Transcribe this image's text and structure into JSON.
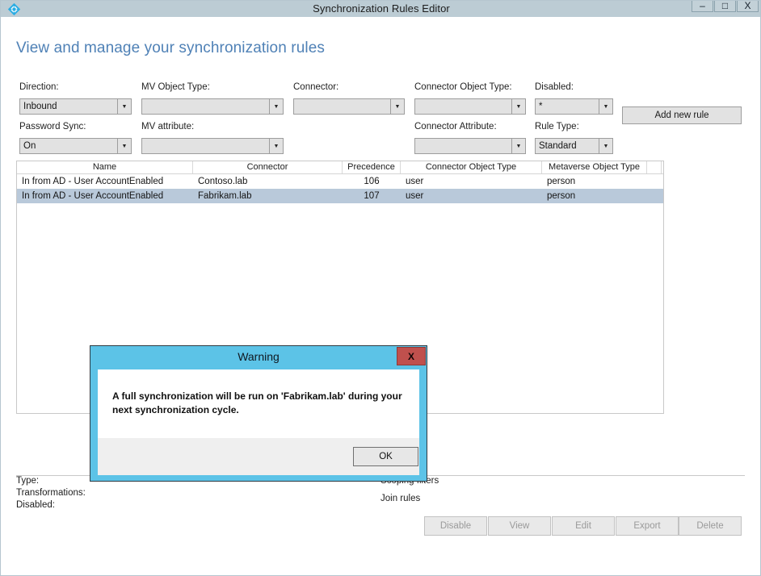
{
  "window": {
    "title": "Synchronization Rules Editor",
    "app_icon": "azure-ad-connect-diamond-icon",
    "controls": {
      "minimize": "–",
      "maximize": "□",
      "close": "X"
    }
  },
  "page": {
    "heading": "View and manage your synchronization rules"
  },
  "filters": {
    "direction": {
      "label": "Direction:",
      "value": "Inbound"
    },
    "mv_object_type": {
      "label": "MV Object Type:",
      "value": ""
    },
    "connector": {
      "label": "Connector:",
      "value": ""
    },
    "connector_object_type": {
      "label": "Connector Object Type:",
      "value": ""
    },
    "disabled": {
      "label": "Disabled:",
      "value": "*"
    },
    "password_sync": {
      "label": "Password Sync:",
      "value": "On"
    },
    "mv_attribute": {
      "label": "MV attribute:",
      "value": ""
    },
    "connector_attribute": {
      "label": "Connector Attribute:",
      "value": ""
    },
    "rule_type": {
      "label": "Rule Type:",
      "value": "Standard"
    },
    "add_new_rule_label": "Add new rule"
  },
  "grid": {
    "columns": [
      "Name",
      "Connector",
      "Precedence",
      "Connector Object Type",
      "Metaverse Object Type",
      ""
    ],
    "rows": [
      {
        "name": "In from AD - User AccountEnabled",
        "connector": "Contoso.lab",
        "precedence": "106",
        "connector_object_type": "user",
        "metaverse_object_type": "person",
        "selected": false
      },
      {
        "name": "In from AD - User AccountEnabled",
        "connector": "Fabrikam.lab",
        "precedence": "107",
        "connector_object_type": "user",
        "metaverse_object_type": "person",
        "selected": true
      }
    ]
  },
  "details": {
    "type_label": "Type:",
    "transformations_label": "Transformations:",
    "disabled_label": "Disabled:",
    "scoping_filters_label": "Scoping filters",
    "join_rules_label": "Join rules"
  },
  "actions": {
    "disable": "Disable",
    "view": "View",
    "edit": "Edit",
    "export": "Export",
    "delete": "Delete"
  },
  "dialog": {
    "title": "Warning",
    "close_label": "X",
    "message": "A full synchronization will be run on 'Fabrikam.lab' during your next synchronization cycle.",
    "ok_label": "OK"
  },
  "colors": {
    "titlebar": "#bcccd4",
    "heading": "#4f81b6",
    "dialog_border": "#5cc3e7",
    "dialog_close": "#c0504d",
    "selected_row": "#b9c9da"
  }
}
